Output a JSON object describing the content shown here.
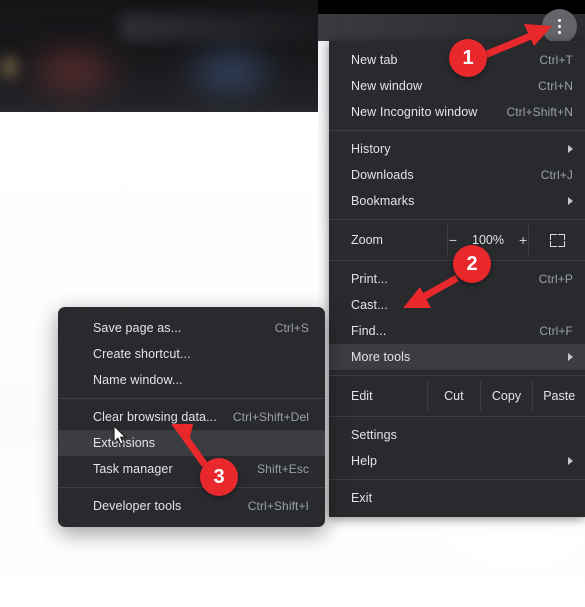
{
  "window": {
    "dots_menu_icon": "three-dot-menu-icon"
  },
  "main_menu": {
    "items": [
      {
        "label": "New tab",
        "accel": "Ctrl+T",
        "type": "item"
      },
      {
        "label": "New window",
        "accel": "Ctrl+N",
        "type": "item"
      },
      {
        "label": "New Incognito window",
        "accel": "Ctrl+Shift+N",
        "type": "item"
      },
      {
        "label": "History",
        "accel": "",
        "type": "submenu"
      },
      {
        "label": "Downloads",
        "accel": "Ctrl+J",
        "type": "item"
      },
      {
        "label": "Bookmarks",
        "accel": "",
        "type": "submenu"
      },
      {
        "label": "Print...",
        "accel": "Ctrl+P",
        "type": "item"
      },
      {
        "label": "Cast...",
        "accel": "",
        "type": "item"
      },
      {
        "label": "Find...",
        "accel": "Ctrl+F",
        "type": "item"
      },
      {
        "label": "More tools",
        "accel": "",
        "type": "submenu",
        "highlighted": true
      },
      {
        "label": "Settings",
        "accel": "",
        "type": "item"
      },
      {
        "label": "Help",
        "accel": "",
        "type": "submenu"
      },
      {
        "label": "Exit",
        "accel": "",
        "type": "item"
      }
    ],
    "zoom_row": {
      "label": "Zoom",
      "minus": "−",
      "level": "100%",
      "plus": "+",
      "fullscreen_icon": "fullscreen-icon"
    },
    "edit_row": {
      "label": "Edit",
      "cut": "Cut",
      "copy": "Copy",
      "paste": "Paste"
    }
  },
  "submenu": {
    "items": [
      {
        "label": "Save page as...",
        "accel": "Ctrl+S"
      },
      {
        "label": "Create shortcut...",
        "accel": ""
      },
      {
        "label": "Name window...",
        "accel": ""
      },
      {
        "label": "Clear browsing data...",
        "accel": "Ctrl+Shift+Del"
      },
      {
        "label": "Extensions",
        "accel": "",
        "highlighted": true
      },
      {
        "label": "Task manager",
        "accel": "Shift+Esc"
      },
      {
        "label": "Developer tools",
        "accel": "Ctrl+Shift+I"
      }
    ]
  },
  "annotations": {
    "accent_color": "#e8282b",
    "badges": [
      {
        "number": "1"
      },
      {
        "number": "2"
      },
      {
        "number": "3"
      }
    ]
  },
  "colors": {
    "menu_background": "#292a2d",
    "menu_highlight": "#3c3d41",
    "menu_text": "#e3e4e6",
    "menu_accel_text": "#9aa0a6",
    "separator": "#3d3e42"
  }
}
